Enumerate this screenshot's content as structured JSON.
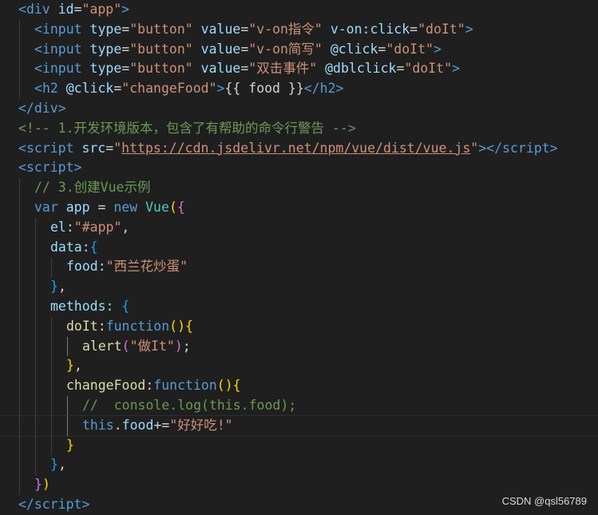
{
  "editor": {
    "lines": [
      {
        "indent": 0,
        "tokens": [
          {
            "t": "<",
            "c": "tag"
          },
          {
            "t": "div",
            "c": "tagname"
          },
          {
            "t": " ",
            "c": "txt"
          },
          {
            "t": "id",
            "c": "attr"
          },
          {
            "t": "=",
            "c": "punct"
          },
          {
            "t": "\"app\"",
            "c": "str"
          },
          {
            "t": ">",
            "c": "tag"
          }
        ]
      },
      {
        "indent": 1,
        "tokens": [
          {
            "t": "<",
            "c": "tag"
          },
          {
            "t": "input",
            "c": "tagname"
          },
          {
            "t": " ",
            "c": "txt"
          },
          {
            "t": "type",
            "c": "attr"
          },
          {
            "t": "=",
            "c": "punct"
          },
          {
            "t": "\"button\"",
            "c": "str"
          },
          {
            "t": " ",
            "c": "txt"
          },
          {
            "t": "value",
            "c": "attr"
          },
          {
            "t": "=",
            "c": "punct"
          },
          {
            "t": "\"v-on指令\"",
            "c": "str"
          },
          {
            "t": " ",
            "c": "txt"
          },
          {
            "t": "v-on:click",
            "c": "attr"
          },
          {
            "t": "=",
            "c": "punct"
          },
          {
            "t": "\"doIt\"",
            "c": "str"
          },
          {
            "t": ">",
            "c": "tag"
          }
        ]
      },
      {
        "indent": 1,
        "tokens": [
          {
            "t": "<",
            "c": "tag"
          },
          {
            "t": "input",
            "c": "tagname"
          },
          {
            "t": " ",
            "c": "txt"
          },
          {
            "t": "type",
            "c": "attr"
          },
          {
            "t": "=",
            "c": "punct"
          },
          {
            "t": "\"button\"",
            "c": "str"
          },
          {
            "t": " ",
            "c": "txt"
          },
          {
            "t": "value",
            "c": "attr"
          },
          {
            "t": "=",
            "c": "punct"
          },
          {
            "t": "\"v-on简写\"",
            "c": "str"
          },
          {
            "t": " ",
            "c": "txt"
          },
          {
            "t": "@click",
            "c": "attr"
          },
          {
            "t": "=",
            "c": "punct"
          },
          {
            "t": "\"doIt\"",
            "c": "str"
          },
          {
            "t": ">",
            "c": "tag"
          }
        ]
      },
      {
        "indent": 1,
        "tokens": [
          {
            "t": "<",
            "c": "tag"
          },
          {
            "t": "input",
            "c": "tagname"
          },
          {
            "t": " ",
            "c": "txt"
          },
          {
            "t": "type",
            "c": "attr"
          },
          {
            "t": "=",
            "c": "punct"
          },
          {
            "t": "\"button\"",
            "c": "str"
          },
          {
            "t": " ",
            "c": "txt"
          },
          {
            "t": "value",
            "c": "attr"
          },
          {
            "t": "=",
            "c": "punct"
          },
          {
            "t": "\"双击事件\"",
            "c": "str"
          },
          {
            "t": " ",
            "c": "txt"
          },
          {
            "t": "@dblclick",
            "c": "attr"
          },
          {
            "t": "=",
            "c": "punct"
          },
          {
            "t": "\"doIt\"",
            "c": "str"
          },
          {
            "t": ">",
            "c": "tag"
          }
        ]
      },
      {
        "indent": 1,
        "tokens": [
          {
            "t": "<",
            "c": "tag"
          },
          {
            "t": "h2",
            "c": "tagname"
          },
          {
            "t": " ",
            "c": "txt"
          },
          {
            "t": "@click",
            "c": "attr"
          },
          {
            "t": "=",
            "c": "punct"
          },
          {
            "t": "\"changeFood\"",
            "c": "str"
          },
          {
            "t": ">",
            "c": "tag"
          },
          {
            "t": "{{ food }}",
            "c": "txt"
          },
          {
            "t": "</",
            "c": "tag"
          },
          {
            "t": "h2",
            "c": "tagname"
          },
          {
            "t": ">",
            "c": "tag"
          }
        ]
      },
      {
        "indent": 0,
        "tokens": [
          {
            "t": "</",
            "c": "tag"
          },
          {
            "t": "div",
            "c": "tagname"
          },
          {
            "t": ">",
            "c": "tag"
          }
        ]
      },
      {
        "indent": 0,
        "tokens": [
          {
            "t": "<!-- 1.开发环境版本，包含了有帮助的命令行警告 -->",
            "c": "com"
          }
        ]
      },
      {
        "indent": 0,
        "tokens": [
          {
            "t": "<",
            "c": "tag"
          },
          {
            "t": "script",
            "c": "tagname"
          },
          {
            "t": " ",
            "c": "txt"
          },
          {
            "t": "src",
            "c": "attr"
          },
          {
            "t": "=",
            "c": "punct"
          },
          {
            "t": "\"",
            "c": "str"
          },
          {
            "t": "https://cdn.jsdelivr.net/npm/vue/dist/vue.js",
            "c": "url"
          },
          {
            "t": "\"",
            "c": "str"
          },
          {
            "t": "></",
            "c": "tag"
          },
          {
            "t": "script",
            "c": "tagname"
          },
          {
            "t": ">",
            "c": "tag"
          }
        ]
      },
      {
        "indent": 0,
        "tokens": [
          {
            "t": "<",
            "c": "tag"
          },
          {
            "t": "script",
            "c": "tagname"
          },
          {
            "t": ">",
            "c": "tag"
          }
        ]
      },
      {
        "indent": 1,
        "tokens": [
          {
            "t": "// 3.创建Vue示例",
            "c": "com"
          }
        ]
      },
      {
        "indent": 1,
        "tokens": [
          {
            "t": "var",
            "c": "kw"
          },
          {
            "t": " ",
            "c": "txt"
          },
          {
            "t": "app",
            "c": "var"
          },
          {
            "t": " = ",
            "c": "punct"
          },
          {
            "t": "new",
            "c": "kw"
          },
          {
            "t": " ",
            "c": "txt"
          },
          {
            "t": "Vue",
            "c": "cls"
          },
          {
            "t": "(",
            "c": "br1"
          },
          {
            "t": "{",
            "c": "br2"
          }
        ]
      },
      {
        "indent": 2,
        "tokens": [
          {
            "t": "el:",
            "c": "key"
          },
          {
            "t": "\"#app\"",
            "c": "str"
          },
          {
            "t": ",",
            "c": "punct"
          }
        ]
      },
      {
        "indent": 2,
        "tokens": [
          {
            "t": "data:",
            "c": "key"
          },
          {
            "t": "{",
            "c": "br3"
          }
        ]
      },
      {
        "indent": 3,
        "tokens": [
          {
            "t": "food:",
            "c": "key"
          },
          {
            "t": "\"西兰花炒蛋\"",
            "c": "str"
          }
        ]
      },
      {
        "indent": 2,
        "tokens": [
          {
            "t": "}",
            "c": "br3"
          },
          {
            "t": ",",
            "c": "punct"
          }
        ]
      },
      {
        "indent": 2,
        "tokens": [
          {
            "t": "methods:",
            "c": "key"
          },
          {
            "t": " ",
            "c": "txt"
          },
          {
            "t": "{",
            "c": "br3"
          }
        ]
      },
      {
        "indent": 3,
        "tokens": [
          {
            "t": "doIt",
            "c": "fn"
          },
          {
            "t": ":",
            "c": "punct"
          },
          {
            "t": "function",
            "c": "kw"
          },
          {
            "t": "(",
            "c": "br1"
          },
          {
            "t": ")",
            "c": "br1"
          },
          {
            "t": "{",
            "c": "br1"
          }
        ]
      },
      {
        "indent": 4,
        "tokens": [
          {
            "t": "alert",
            "c": "fn"
          },
          {
            "t": "(",
            "c": "br2"
          },
          {
            "t": "\"做It\"",
            "c": "str"
          },
          {
            "t": ")",
            "c": "br2"
          },
          {
            "t": ";",
            "c": "punct"
          }
        ]
      },
      {
        "indent": 3,
        "tokens": [
          {
            "t": "}",
            "c": "br1"
          },
          {
            "t": ",",
            "c": "punct"
          }
        ]
      },
      {
        "indent": 3,
        "tokens": [
          {
            "t": "changeFood",
            "c": "fn"
          },
          {
            "t": ":",
            "c": "punct"
          },
          {
            "t": "function",
            "c": "kw"
          },
          {
            "t": "(",
            "c": "br1"
          },
          {
            "t": ")",
            "c": "br1"
          },
          {
            "t": "{",
            "c": "br1"
          }
        ]
      },
      {
        "indent": 4,
        "tokens": [
          {
            "t": "//  console.log(this.food);",
            "c": "com"
          }
        ]
      },
      {
        "indent": 4,
        "cursor": true,
        "tokens": [
          {
            "t": "this",
            "c": "kw"
          },
          {
            "t": ".",
            "c": "punct"
          },
          {
            "t": "food",
            "c": "var"
          },
          {
            "t": "+=",
            "c": "punct"
          },
          {
            "t": "\"好好吃!\"",
            "c": "str"
          }
        ]
      },
      {
        "indent": 3,
        "tokens": [
          {
            "t": "}",
            "c": "br1"
          }
        ]
      },
      {
        "indent": 2,
        "tokens": [
          {
            "t": "}",
            "c": "br3"
          },
          {
            "t": ",",
            "c": "punct"
          }
        ]
      },
      {
        "indent": 1,
        "tokens": [
          {
            "t": "}",
            "c": "br2"
          },
          {
            "t": ")",
            "c": "br1"
          }
        ]
      },
      {
        "indent": 0,
        "tokens": [
          {
            "t": "</",
            "c": "tag"
          },
          {
            "t": "script",
            "c": "tagname"
          },
          {
            "t": ">",
            "c": "tag"
          }
        ]
      }
    ]
  },
  "watermark": "CSDN @qsl56789"
}
